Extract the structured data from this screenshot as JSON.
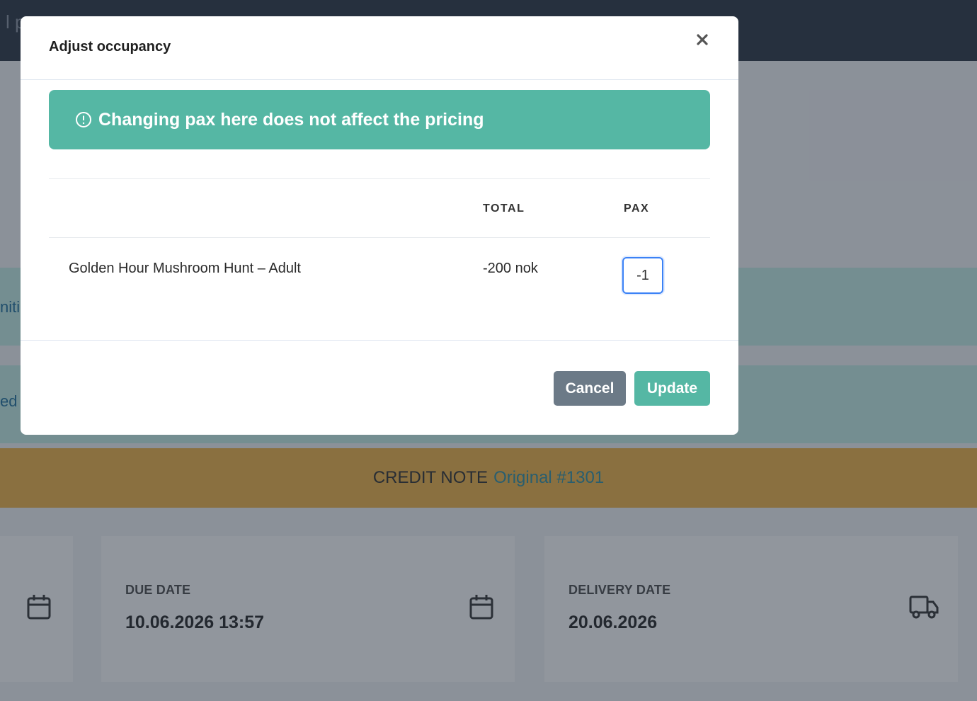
{
  "background": {
    "topbar_title": "l p",
    "band_1_text": "nitia",
    "band_2_text": "ed",
    "credit_note": {
      "label": "CREDIT NOTE",
      "link": "Original #1301"
    },
    "cards": [
      {
        "label": "",
        "value": "",
        "icon": "calendar-icon"
      },
      {
        "label": "DUE DATE",
        "value": "10.06.2026 13:57",
        "icon": "calendar-icon"
      },
      {
        "label": "DELIVERY DATE",
        "value": "20.06.2026",
        "icon": "truck-icon"
      }
    ]
  },
  "modal": {
    "title": "Adjust occupancy",
    "close_icon": "close-icon",
    "alert": {
      "icon": "info-circle-icon",
      "text": "Changing pax here does not affect the pricing"
    },
    "table": {
      "columns": {
        "name": "",
        "total": "TOTAL",
        "pax": "PAX"
      },
      "rows": [
        {
          "name": "Golden Hour Mushroom Hunt – Adult",
          "total": "-200 nok",
          "pax": "-1"
        }
      ]
    },
    "buttons": {
      "cancel": "Cancel",
      "update": "Update"
    }
  },
  "colors": {
    "topbar": "#283341",
    "accent": "#55b7a4",
    "credit_bar": "#f0b345",
    "cancel": "#6c7a87",
    "focus": "#3b82f6"
  }
}
